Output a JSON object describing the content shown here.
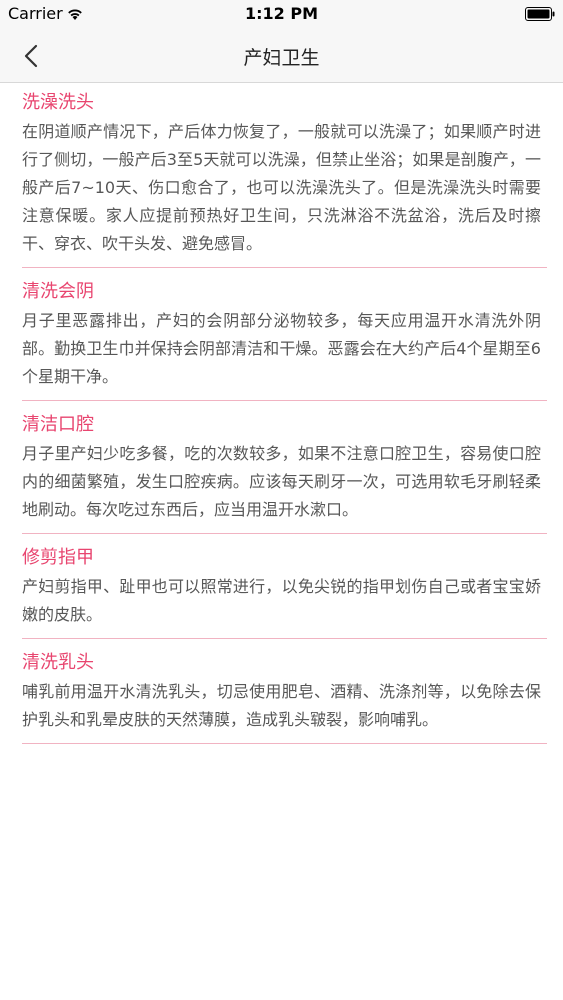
{
  "status_bar": {
    "carrier": "Carrier",
    "time": "1:12 PM"
  },
  "nav": {
    "title": "产妇卫生",
    "back_icon": "chevron-left-icon"
  },
  "colors": {
    "accent": "#e8456f",
    "divider": "#f1b3c2",
    "body_text": "#575757",
    "nav_bg": "#f7f7f7"
  },
  "sections": [
    {
      "title": "洗澡洗头",
      "body": "在阴道顺产情况下，产后体力恢复了，一般就可以洗澡了；如果顺产时进行了侧切，一般产后3至5天就可以洗澡，但禁止坐浴；如果是剖腹产，一般产后7~10天、伤口愈合了，也可以洗澡洗头了。但是洗澡洗头时需要注意保暖。家人应提前预热好卫生间，只洗淋浴不洗盆浴，洗后及时擦干、穿衣、吹干头发、避免感冒。"
    },
    {
      "title": "清洗会阴",
      "body": "月子里恶露排出，产妇的会阴部分泌物较多，每天应用温开水清洗外阴部。勤换卫生巾并保持会阴部清洁和干燥。恶露会在大约产后4个星期至6个星期干净。"
    },
    {
      "title": "清洁口腔",
      "body": "月子里产妇少吃多餐，吃的次数较多，如果不注意口腔卫生，容易使口腔内的细菌繁殖，发生口腔疾病。应该每天刷牙一次，可选用软毛牙刷轻柔地刷动。每次吃过东西后，应当用温开水漱口。"
    },
    {
      "title": "修剪指甲",
      "body": "产妇剪指甲、趾甲也可以照常进行，以免尖锐的指甲划伤自己或者宝宝娇嫩的皮肤。"
    },
    {
      "title": "清洗乳头",
      "body": "哺乳前用温开水清洗乳头，切忌使用肥皂、酒精、洗涤剂等，以免除去保护乳头和乳晕皮肤的天然薄膜，造成乳头皲裂，影响哺乳。"
    }
  ]
}
